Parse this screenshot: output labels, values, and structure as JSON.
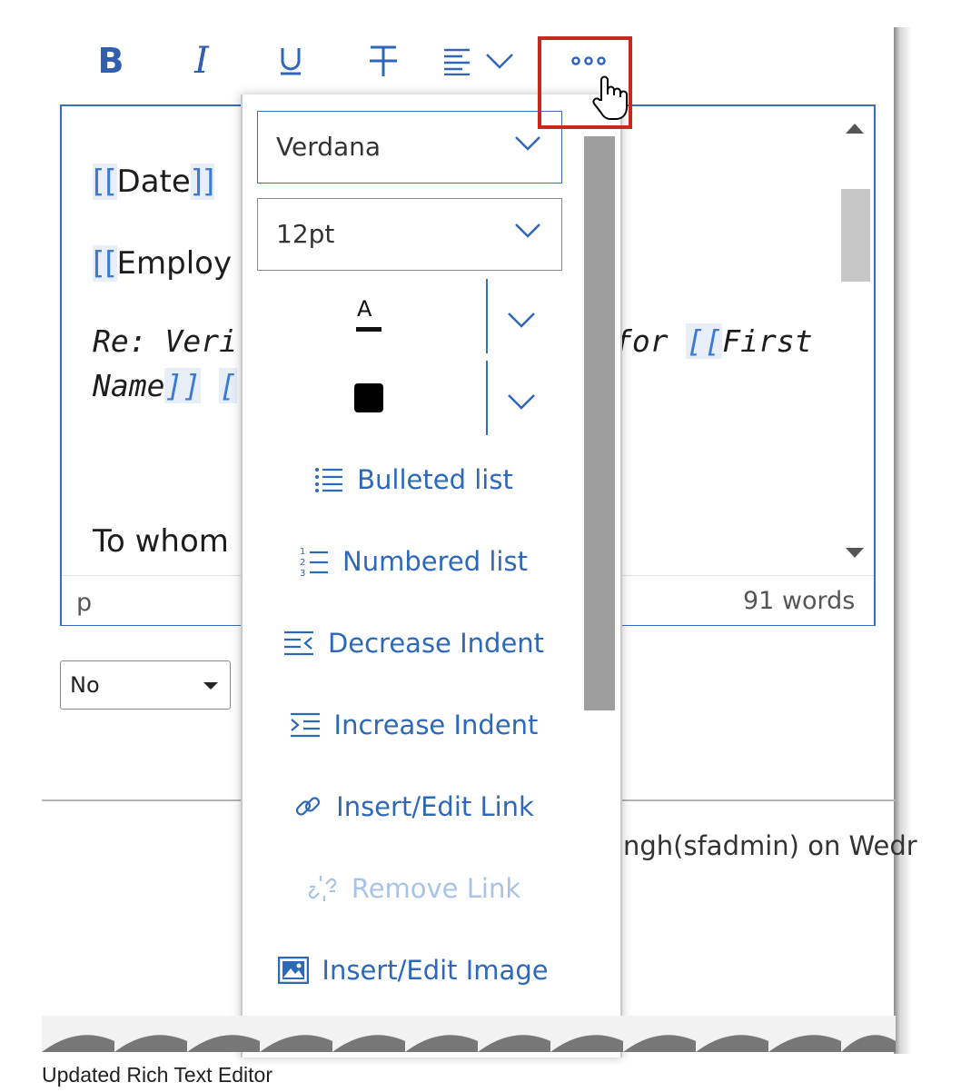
{
  "toolbar": {
    "bold": "B",
    "italic": "I",
    "icons": [
      "underline-icon",
      "strikethrough-icon",
      "align-icon",
      "more-icon"
    ]
  },
  "editor": {
    "line_date_open": "[[",
    "line_date": "Date",
    "line_date_close": "]]",
    "line_emp_open": "[[",
    "line_emp": "Employ",
    "line_re": "Re: Verif",
    "line_for": "for ",
    "line_first_open": "[[",
    "line_first": "First",
    "line_name": "Name",
    "line_name_close": "]]",
    "line_name_open2": "[",
    "line_whom": "To whom",
    "status_tag": "p",
    "word_count": "91 words"
  },
  "select_no": "No",
  "footer_text": "ngh(sfadmin) on Wedr",
  "menu": {
    "font_family": "Verdana",
    "font_size": "12pt",
    "text_color_letter": "A",
    "items": [
      {
        "label": "Bulleted list",
        "icon": "bulleted-list-icon",
        "disabled": false
      },
      {
        "label": "Numbered list",
        "icon": "numbered-list-icon",
        "disabled": false
      },
      {
        "label": "Decrease Indent",
        "icon": "decrease-indent-icon",
        "disabled": false
      },
      {
        "label": "Increase Indent",
        "icon": "increase-indent-icon",
        "disabled": false
      },
      {
        "label": "Insert/Edit Link",
        "icon": "link-icon",
        "disabled": false
      },
      {
        "label": "Remove Link",
        "icon": "unlink-icon",
        "disabled": true
      },
      {
        "label": "Insert/Edit Image",
        "icon": "image-icon",
        "disabled": false
      }
    ]
  },
  "caption": "Updated Rich Text Editor",
  "colors": {
    "accent": "#2d68b9",
    "highlight_box": "#c7281f"
  }
}
